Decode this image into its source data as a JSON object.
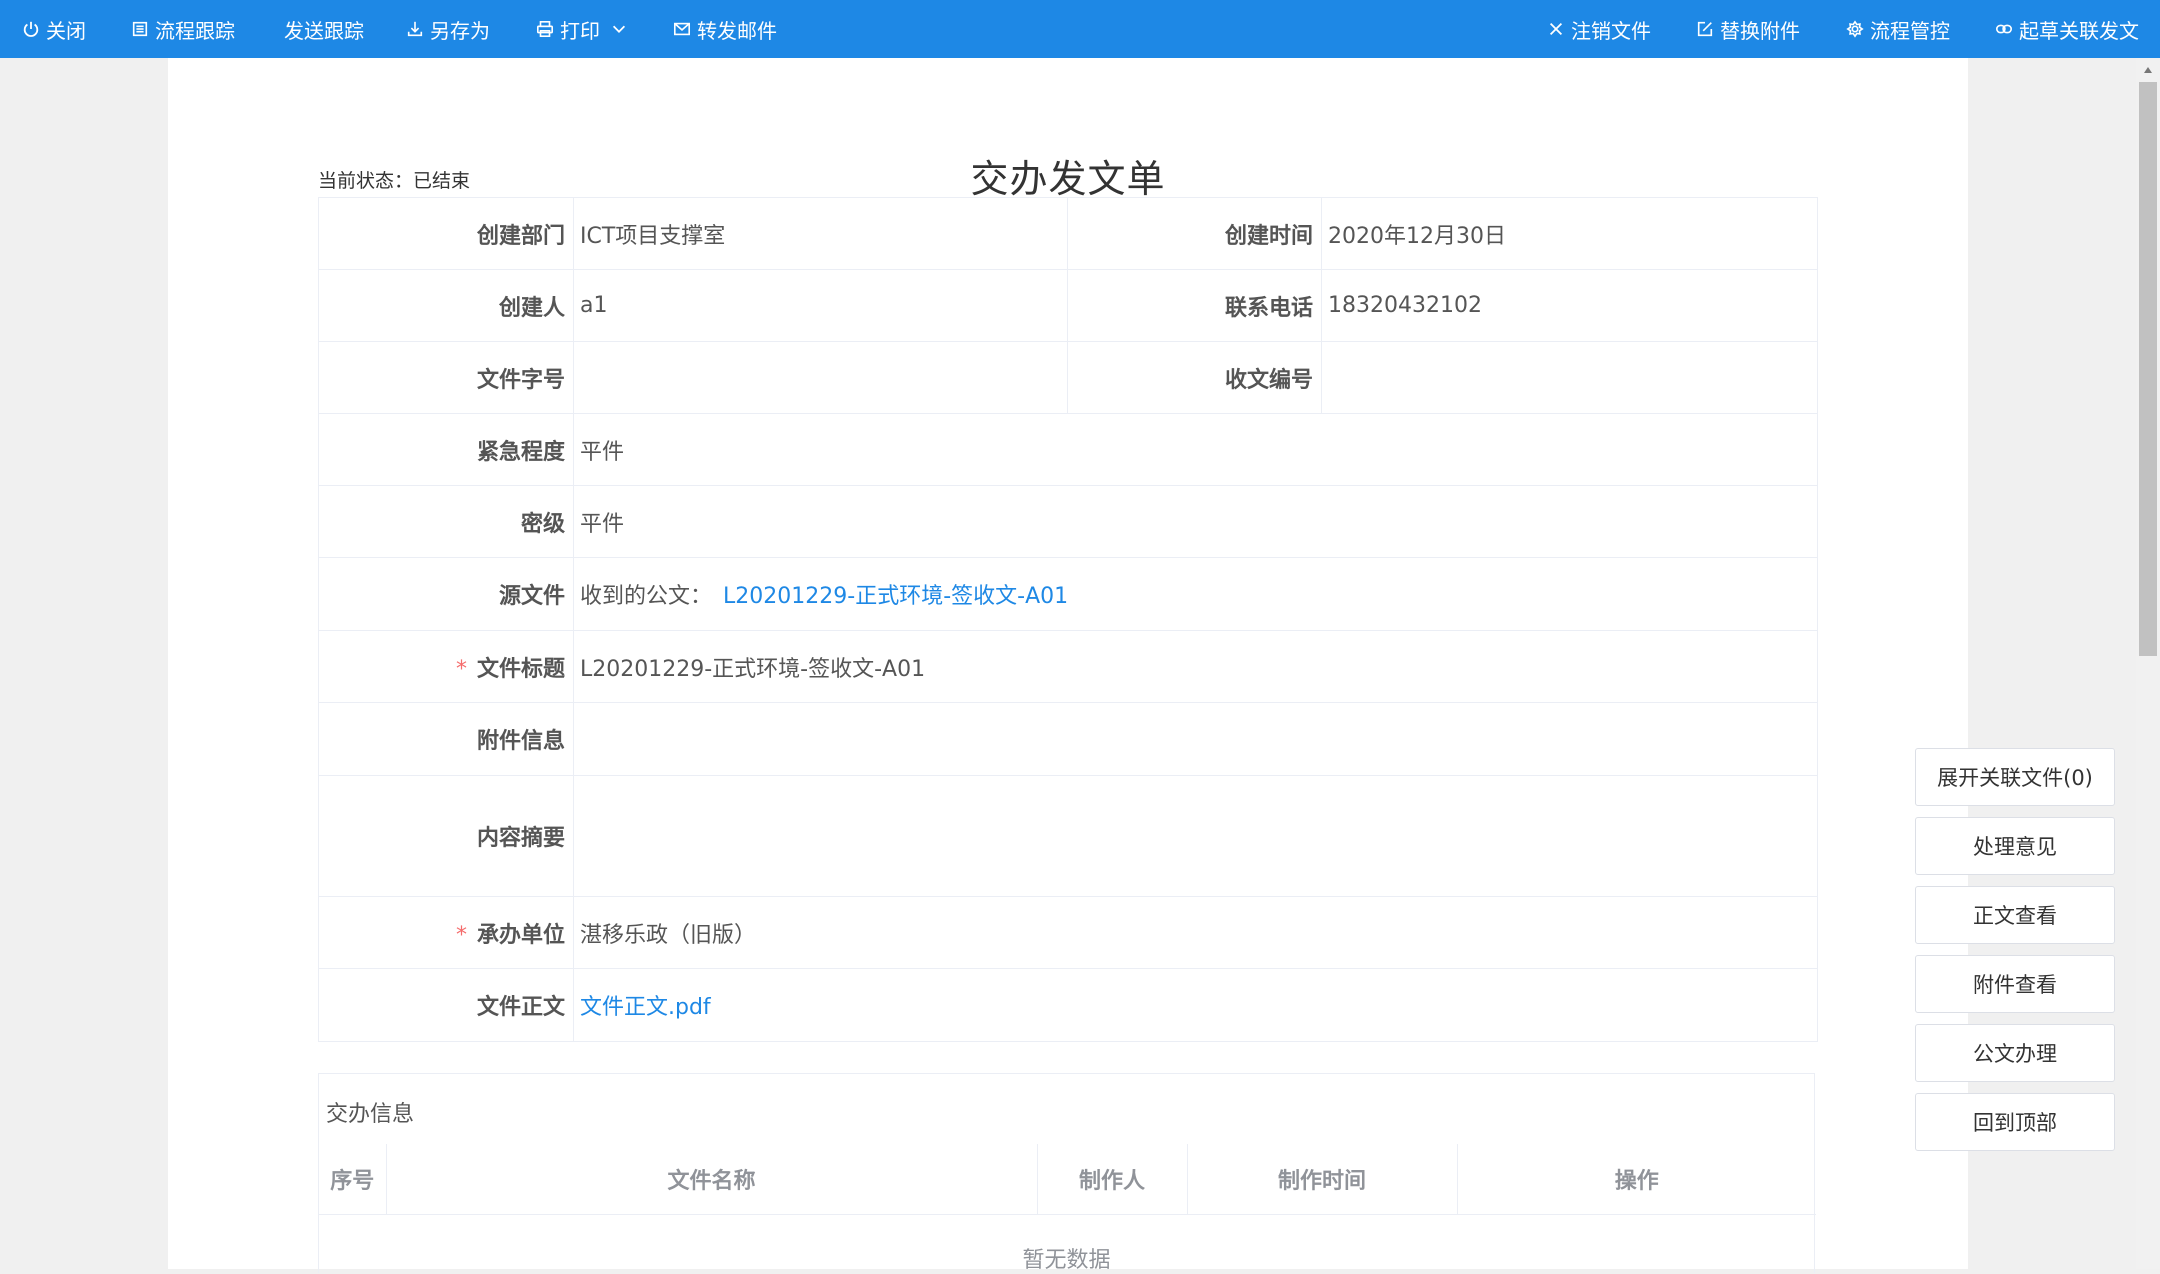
{
  "toolbar": {
    "left": [
      {
        "icon": "power-icon",
        "label": "关闭"
      },
      {
        "icon": "list-icon",
        "label": "流程跟踪"
      },
      {
        "icon": "",
        "label": "发送跟踪"
      },
      {
        "icon": "download-icon",
        "label": "另存为"
      },
      {
        "icon": "printer-icon",
        "label": "打印"
      },
      {
        "icon": "mail-icon",
        "label": "转发邮件"
      }
    ],
    "right": [
      {
        "icon": "close-icon",
        "label": "注销文件"
      },
      {
        "icon": "edit-icon",
        "label": "替换附件"
      },
      {
        "icon": "gear-icon",
        "label": "流程管控"
      },
      {
        "icon": "link-icon",
        "label": "起草关联发文"
      }
    ],
    "background": "#1e88e5"
  },
  "document": {
    "title": "交办发文单",
    "status": "当前状态：已结束"
  },
  "form": {
    "dept_label": "创建部门",
    "dept_value": "ICT项目支撑室",
    "created_time_label": "创建时间",
    "created_time_value": "2020年12月30日",
    "creator_label": "创建人",
    "creator_value": "a1",
    "phone_label": "联系电话",
    "phone_value": "18320432102",
    "file_no_label": "文件字号",
    "file_no_value": "",
    "receive_no_label": "收文编号",
    "receive_no_value": "",
    "urgency_label": "紧急程度",
    "urgency_value": "平件",
    "secret_label": "密级",
    "secret_value": "平件",
    "source_label": "源文件",
    "source_prefix": "收到的公文：",
    "source_link": "L20201229-正式环境-签收文-A01",
    "required_mark": "*",
    "file_title_label": "文件标题",
    "file_title_value": "L20201229-正式环境-签收文-A01",
    "attachment_label": "附件信息",
    "attachment_value": "",
    "summary_label": "内容摘要",
    "summary_value": "",
    "handler_label": "承办单位",
    "handler_value": "湛移乐政（旧版）",
    "body_label": "文件正文",
    "body_link": "文件正文.pdf"
  },
  "assign_info": {
    "title": "交办信息",
    "columns": [
      "序号",
      "文件名称",
      "制作人",
      "制作时间",
      "操作"
    ],
    "empty_text": "暂无数据"
  },
  "side_buttons": [
    "展开关联文件(0)",
    "处理意见",
    "正文查看",
    "附件查看",
    "公文办理",
    "回到顶部"
  ],
  "colors": {
    "accent": "#1e88e5",
    "required": "#f56c6c"
  }
}
